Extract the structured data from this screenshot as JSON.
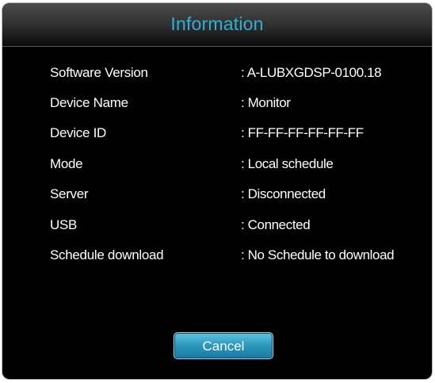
{
  "dialog": {
    "title": "Information",
    "rows": [
      {
        "label": "Software Version",
        "value": ": A-LUBXGDSP-0100.18"
      },
      {
        "label": "Device Name",
        "value": ": Monitor"
      },
      {
        "label": "Device ID",
        "value": ": FF-FF-FF-FF-FF-FF"
      },
      {
        "label": "Mode",
        "value": ": Local schedule"
      },
      {
        "label": "Server",
        "value": ": Disconnected"
      },
      {
        "label": "USB",
        "value": ": Connected"
      },
      {
        "label": "Schedule download",
        "value": ": No Schedule to download"
      }
    ],
    "cancel_label": "Cancel"
  },
  "colors": {
    "title": "#2db0d8",
    "background": "#000000",
    "button": "#2b96bb",
    "text": "#ffffff"
  }
}
